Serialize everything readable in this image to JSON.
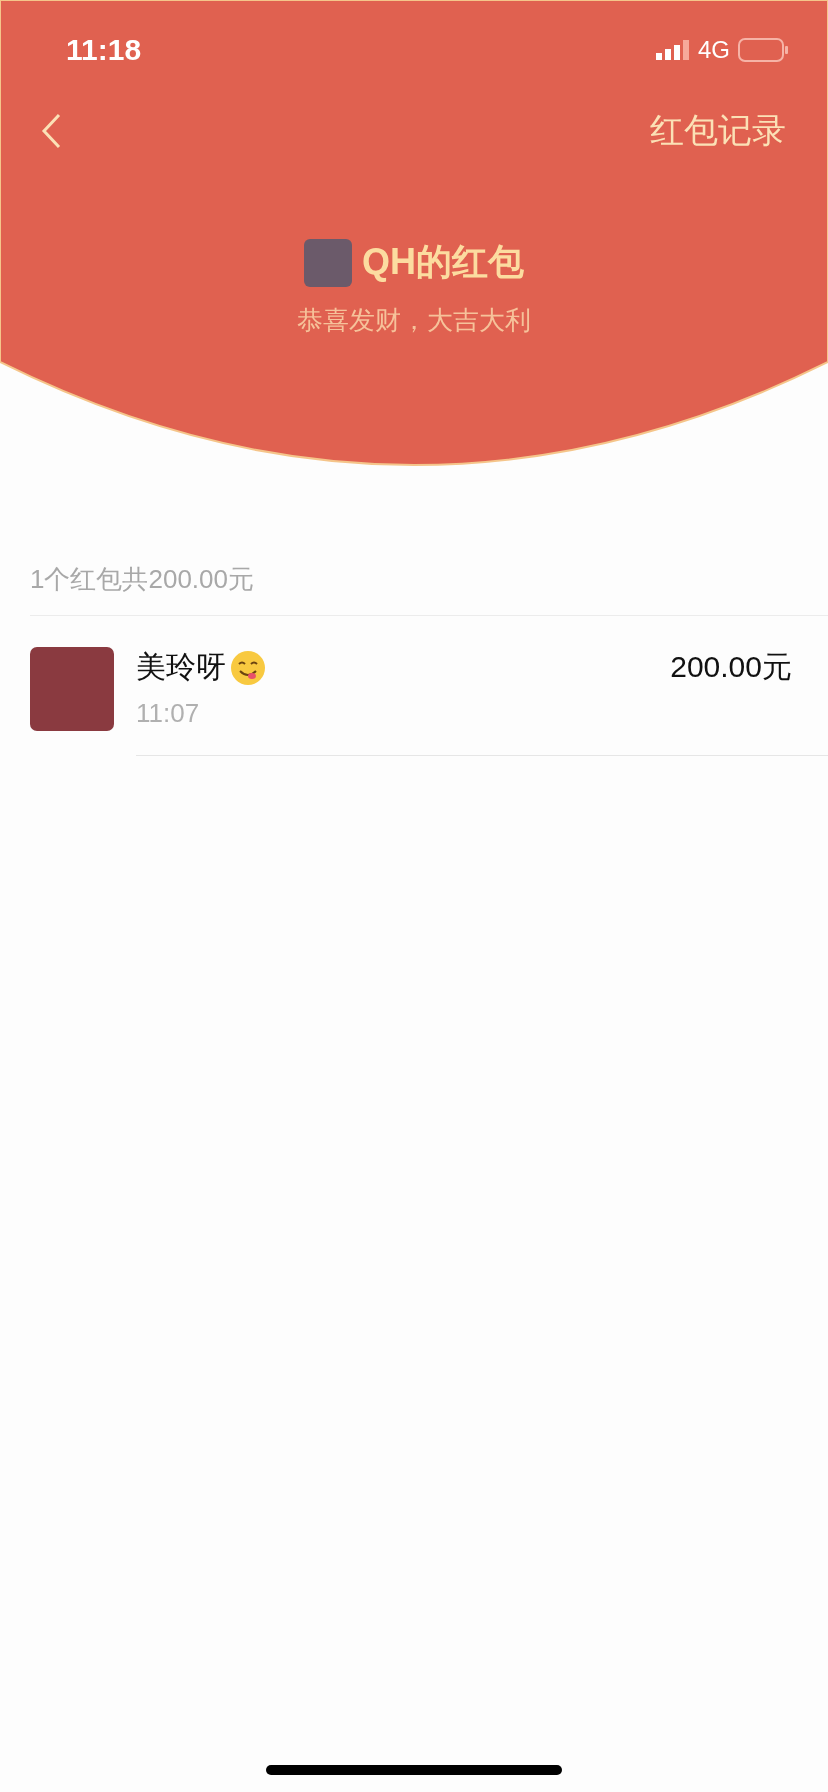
{
  "status_bar": {
    "time": "11:18",
    "network": "4G"
  },
  "nav": {
    "action": "红包记录"
  },
  "packet": {
    "title": "QH的红包",
    "wish": "恭喜发财，大吉大利"
  },
  "summary": "1个红包共200.00元",
  "receivers": [
    {
      "name": "美玲呀",
      "time": "11:07",
      "amount": "200.00元"
    }
  ]
}
